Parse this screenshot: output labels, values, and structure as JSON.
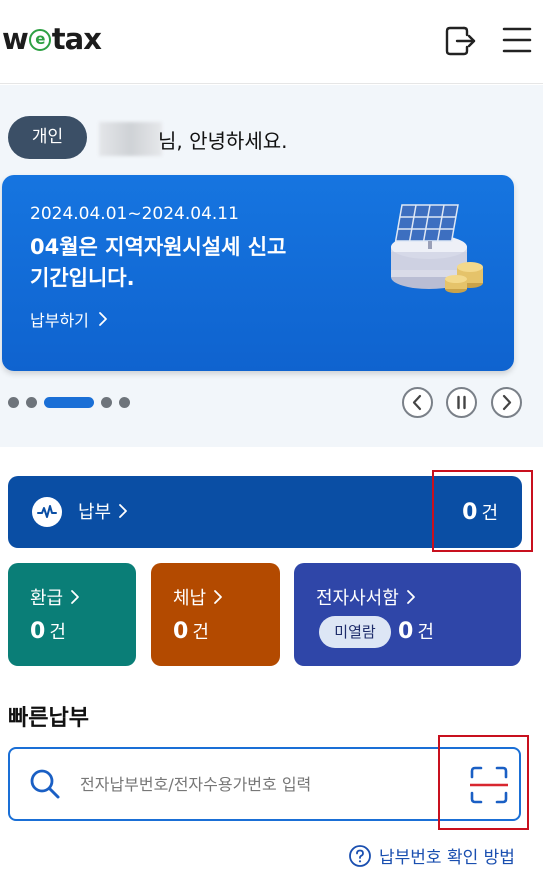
{
  "header": {
    "logo_prefix": "w",
    "logo_e": "e",
    "logo_suffix": "tax",
    "logout_icon": "logout-icon",
    "menu_icon": "hamburger-menu-icon"
  },
  "greeting": {
    "badge": "개인",
    "text": "님, 안녕하세요."
  },
  "banner": {
    "date": "2024.04.01~2024.04.11",
    "title": "04월은 지역자원시설세 신고\n기간입니다.",
    "link_label": "납부하기",
    "illustration": "solar-panel-coins-illustration"
  },
  "carousel": {
    "dot_count": 5,
    "active_index": 2,
    "controls": [
      "prev",
      "pause",
      "next"
    ]
  },
  "summary": {
    "pay": {
      "label": "납부",
      "count": "0",
      "unit": "건"
    },
    "refund": {
      "label": "환급",
      "count": "0",
      "unit": "건"
    },
    "arrears": {
      "label": "체납",
      "count": "0",
      "unit": "건"
    },
    "edoc": {
      "label": "전자사서함",
      "badge": "미열람",
      "count": "0",
      "unit": "건"
    }
  },
  "colors": {
    "pay_card": "#0a4ea4",
    "refund_card": "#0a7e77",
    "arrears_card": "#b34a00",
    "edoc_card": "#2f46a8",
    "banner": "#1675e0",
    "highlight": "#c8101e"
  },
  "quick_pay": {
    "title": "빠른납부",
    "placeholder": "전자납부번호/전자수용가번호 입력",
    "help_label": "납부번호 확인 방법"
  }
}
